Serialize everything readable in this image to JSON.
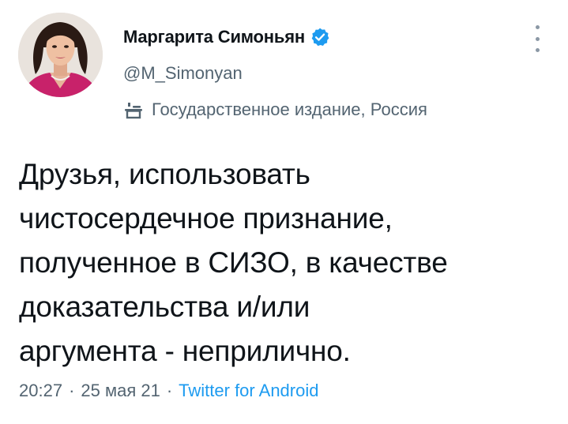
{
  "profile": {
    "display_name": "Маргарита Симоньян",
    "handle": "@M_Simonyan",
    "verified": true,
    "label": "Государственное издание, Россия",
    "label_icon": "podium-icon"
  },
  "tweet": {
    "lines": [
      "Друзья, использовать",
      "чистосердечное признание,",
      "полученное в СИЗО, в качестве",
      "доказательства и/или",
      "аргумента - неприлично."
    ],
    "time": "20:27",
    "date": "25 мая 21",
    "separator": "·",
    "source": "Twitter for Android"
  },
  "colors": {
    "accent": "#1d9bf0",
    "secondary_text": "#536471",
    "primary_text": "#0f1419"
  }
}
